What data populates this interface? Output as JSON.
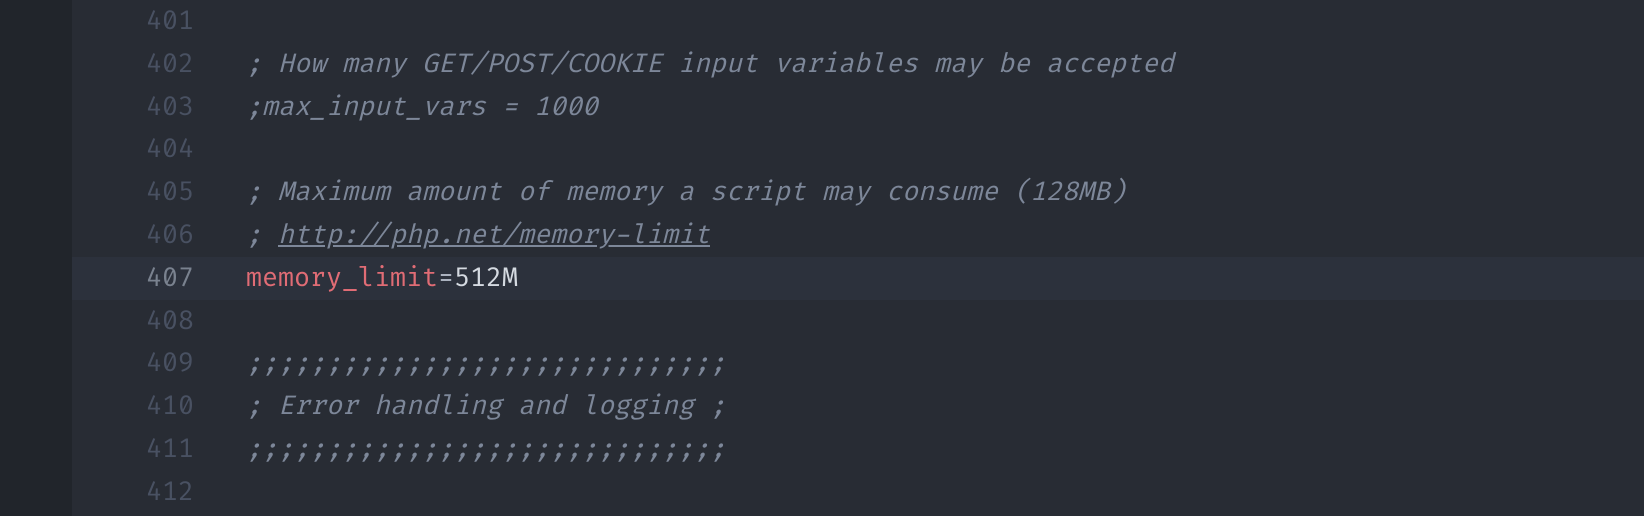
{
  "editor": {
    "lines": [
      {
        "num": "401",
        "highlighted": false,
        "segments": []
      },
      {
        "num": "402",
        "highlighted": false,
        "segments": [
          {
            "cls": "tok-comment",
            "text": "; How many GET/POST/COOKIE input variables may be accepted"
          }
        ]
      },
      {
        "num": "403",
        "highlighted": false,
        "segments": [
          {
            "cls": "tok-comment",
            "text": ";max_input_vars = 1000"
          }
        ]
      },
      {
        "num": "404",
        "highlighted": false,
        "segments": []
      },
      {
        "num": "405",
        "highlighted": false,
        "segments": [
          {
            "cls": "tok-comment",
            "text": "; Maximum amount of memory a script may consume (128MB)"
          }
        ]
      },
      {
        "num": "406",
        "highlighted": false,
        "segments": [
          {
            "cls": "tok-comment",
            "text": "; "
          },
          {
            "cls": "tok-link",
            "text": "http://php.net/memory-limit"
          }
        ]
      },
      {
        "num": "407",
        "highlighted": true,
        "segments": [
          {
            "cls": "tok-key",
            "text": "memory_limit"
          },
          {
            "cls": "tok-op",
            "text": "="
          },
          {
            "cls": "tok-val",
            "text": "512M"
          }
        ]
      },
      {
        "num": "408",
        "highlighted": false,
        "segments": []
      },
      {
        "num": "409",
        "highlighted": false,
        "segments": [
          {
            "cls": "tok-comment",
            "text": ";;;;;;;;;;;;;;;;;;;;;;;;;;;;;;"
          }
        ]
      },
      {
        "num": "410",
        "highlighted": false,
        "segments": [
          {
            "cls": "tok-comment",
            "text": "; Error handling and logging ;"
          }
        ]
      },
      {
        "num": "411",
        "highlighted": false,
        "segments": [
          {
            "cls": "tok-comment",
            "text": ";;;;;;;;;;;;;;;;;;;;;;;;;;;;;;"
          }
        ]
      },
      {
        "num": "412",
        "highlighted": false,
        "segments": []
      }
    ]
  }
}
